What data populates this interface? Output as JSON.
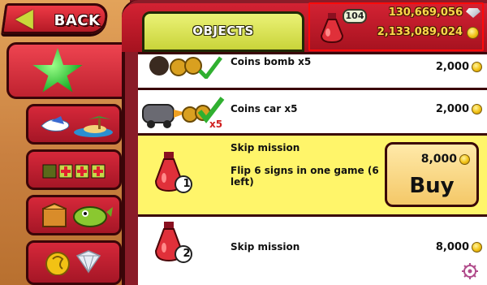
{
  "header": {
    "back_label": "BACK",
    "objects_tab_label": "OBJECTS",
    "potion_count": "104",
    "gems_amount": "130,669,056",
    "coins_amount": "2,133,089,024"
  },
  "items": [
    {
      "name": "Coins bomb x5",
      "price": "2,000",
      "selected": false,
      "icon": "coins-bomb-icon"
    },
    {
      "name": "Coins car x5",
      "price": "2,000",
      "selected": false,
      "icon": "coins-car-icon"
    },
    {
      "name": "Skip mission",
      "description": "Flip 6 signs in one game (6 left)",
      "price": "8,000",
      "buy_label": "Buy",
      "potion_number": "1",
      "selected": true,
      "icon": "skip-mission-potion-icon"
    },
    {
      "name": "Skip mission",
      "price": "8,000",
      "potion_number": "2",
      "selected": false,
      "icon": "skip-mission-potion-icon"
    }
  ],
  "sidebar": {
    "items": [
      {
        "icon": "star-icon",
        "active": true
      },
      {
        "icon": "island-sky-icon",
        "active": false
      },
      {
        "icon": "upgrade-plus-icon",
        "active": false
      },
      {
        "icon": "box-fish-icon",
        "active": false
      },
      {
        "icon": "coin-gem-icon",
        "active": false
      }
    ]
  },
  "colors": {
    "accent_red": "#d32233",
    "objects_tab": "#c9d43a",
    "selected_row": "#fff56a",
    "currency_gold": "#ffd84a",
    "highlight_box": "#ff0a0a"
  }
}
